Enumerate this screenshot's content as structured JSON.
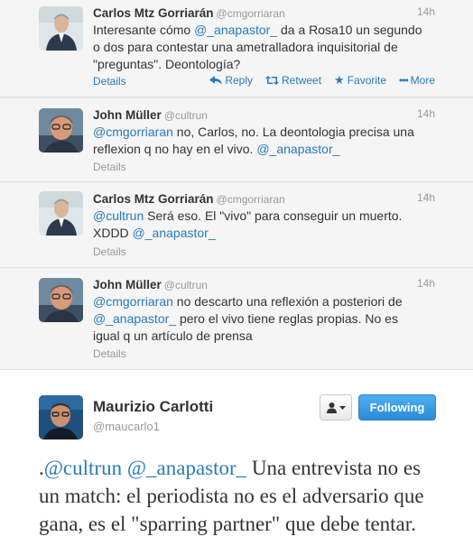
{
  "tweets": [
    {
      "name": "Carlos Mtz Gorriarán",
      "handle": "@cmgorriaran",
      "time": "14h",
      "text_parts": {
        "a": "Interesante cómo ",
        "m1": "@_anapastor_",
        "b": " da a Rosa10 un segundo o dos para contestar una ametralladora inquisitorial de \"preguntas\". Deontología?"
      },
      "details": "Details",
      "actions": {
        "reply": "Reply",
        "retweet": "Retweet",
        "favorite": "Favorite",
        "more": "More"
      },
      "avatar": "avatar-carlos"
    },
    {
      "name": "John Müller",
      "handle": "@cultrun",
      "time": "14h",
      "text_parts": {
        "m1": "@cmgorriaran",
        "a": " no, Carlos, no. La deontologia precisa una reflexion q no hay en el vivo. ",
        "m2": "@_anapastor_"
      },
      "details": "Details",
      "avatar": "avatar-john"
    },
    {
      "name": "Carlos Mtz Gorriarán",
      "handle": "@cmgorriaran",
      "time": "14h",
      "text_parts": {
        "m1": "@cultrun",
        "a": " Será eso. El \"vivo\" para conseguir un muerto. XDDD ",
        "m2": "@_anapastor_"
      },
      "details": "Details",
      "avatar": "avatar-carlos"
    },
    {
      "name": "John Müller",
      "handle": "@cultrun",
      "time": "14h",
      "text_parts": {
        "m1": "@cmgorriaran",
        "a": " no descarto una reflexión a posteriori de ",
        "m2": "@_anapastor_",
        "b": " pero el vivo tiene reglas propias. No es igual q un artículo de prensa"
      },
      "details": "Details",
      "avatar": "avatar-john"
    }
  ],
  "expanded": {
    "name": "Maurizio Carlotti",
    "handle": "@maucarlo1",
    "follow_label": "Following",
    "user_dropdown_icon": "user-dropdown-icon",
    "text_parts": {
      "a": ".",
      "m1": "@cultrun",
      "sp": " ",
      "m2": "@_anapastor_",
      "b": " Una entrevista no es un match: el periodista no es el adversario que gana, es el \"sparring partner\" que debe tentar."
    }
  },
  "colors": {
    "link": "#2a7ab8",
    "follow_button": "#2a8ad8",
    "muted": "#999999",
    "stream_bg": "#f5f5f5"
  }
}
